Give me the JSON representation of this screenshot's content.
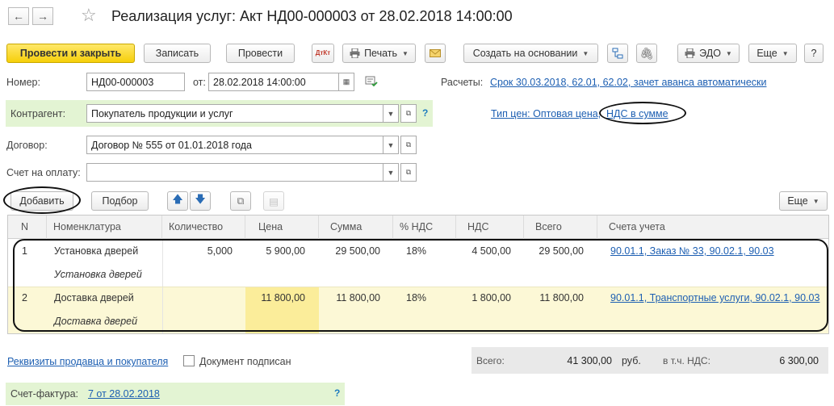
{
  "window": {
    "title": "Реализация услуг: Акт НД00-000003 от 28.02.2018 14:00:00",
    "back_icon": "←",
    "forward_icon": "→",
    "star_icon": "☆"
  },
  "toolbar": {
    "post_close": "Провести и закрыть",
    "save": "Записать",
    "post": "Провести",
    "dt_kt": "ДтКт",
    "print": "Печать",
    "create_based": "Создать на основании",
    "edo": "ЭДО",
    "more": "Еще",
    "help": "?"
  },
  "form": {
    "number_label": "Номер:",
    "number_value": "НД00-000003",
    "date_label": "от:",
    "date_value": "28.02.2018 14:00:00",
    "settlements_label": "Расчеты:",
    "settlements_link": "Срок 30.03.2018, 62.01, 62.02, зачет аванса автоматически",
    "counterparty_label": "Контрагент:",
    "counterparty_value": "Покупатель продукции и услуг",
    "price_type_link": "Тип цен: Оптовая цена,",
    "vat_link": "НДС в сумме",
    "contract_label": "Договор:",
    "contract_value": "Договор № 555 от 01.01.2018 года",
    "invoice_label": "Счет на оплату:",
    "invoice_value": "",
    "help": "?"
  },
  "table_toolbar": {
    "add": "Добавить",
    "pick": "Подбор",
    "more": "Еще"
  },
  "table": {
    "headers": [
      "N",
      "Номенклатура",
      "Количество",
      "Цена",
      "Сумма",
      "% НДС",
      "НДС",
      "Всего",
      "Счета учета"
    ],
    "rows": [
      {
        "n": "1",
        "item": "Установка дверей",
        "item_sub": "Установка дверей",
        "qty": "5,000",
        "price": "5 900,00",
        "sum": "29 500,00",
        "vat_rate": "18%",
        "vat": "4 500,00",
        "total": "29 500,00",
        "accounts": "90.01.1, Заказ № 33, 90.02.1, 90.03"
      },
      {
        "n": "2",
        "item": "Доставка дверей",
        "item_sub": "Доставка дверей",
        "qty": "",
        "price": "11 800,00",
        "sum": "11 800,00",
        "vat_rate": "18%",
        "vat": "1 800,00",
        "total": "11 800,00",
        "accounts": "90.01.1, Транспортные услуги, 90.02.1, 90.03"
      }
    ]
  },
  "footer": {
    "requisites_link": "Реквизиты продавца и покупателя",
    "signed_label": "Документ подписан",
    "total_label": "Всего:",
    "total_value": "41 300,00",
    "currency": "руб.",
    "vat_label": "в т.ч. НДС:",
    "vat_value": "6 300,00",
    "invoice_label": "Счет-фактура:",
    "invoice_link": "7  от 28.02.2018",
    "help": "?"
  },
  "colors": {
    "primary_button": "#f6cf0a",
    "link": "#1d5fb2",
    "highlight_green": "#e3f4d3",
    "selected_row": "#fcf8d6"
  }
}
